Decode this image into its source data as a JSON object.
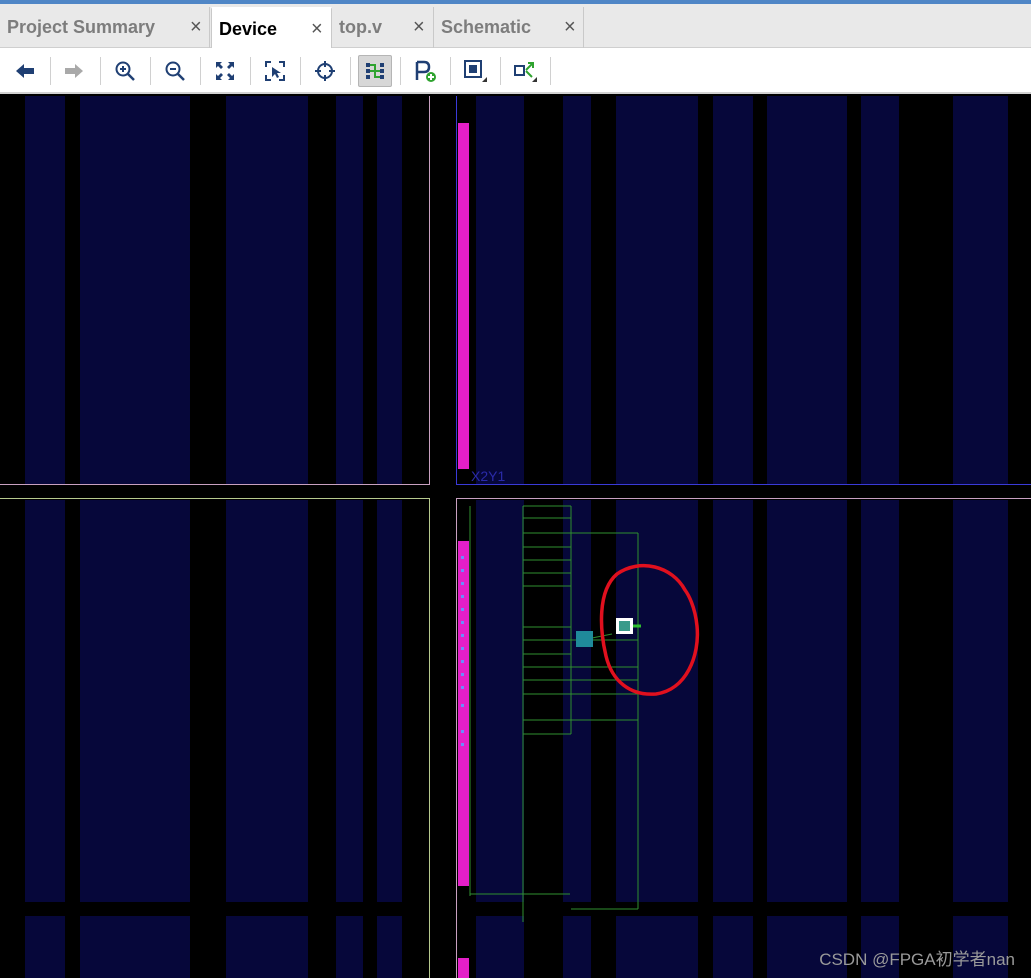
{
  "tabs": [
    {
      "label": "Project Summary",
      "active": false
    },
    {
      "label": "Device",
      "active": true
    },
    {
      "label": "top.v",
      "active": false
    },
    {
      "label": "Schematic",
      "active": false
    }
  ],
  "close_glyph": "×",
  "toolbar": {
    "buttons": [
      {
        "icon": "back-arrow-icon"
      },
      {
        "icon": "forward-arrow-icon"
      },
      {
        "icon": "zoom-in-icon"
      },
      {
        "icon": "zoom-out-icon"
      },
      {
        "icon": "zoom-fit-icon"
      },
      {
        "icon": "zoom-selection-icon"
      },
      {
        "icon": "crosshair-icon"
      },
      {
        "icon": "routing-resources-icon",
        "pressed": true
      },
      {
        "icon": "add-pblock-icon"
      },
      {
        "icon": "fixed-cells-icon"
      },
      {
        "icon": "autofit-selection-icon"
      }
    ]
  },
  "device_view": {
    "clock_region_label": "X2Y1",
    "colors": {
      "background": "#000000",
      "tile_column": "#06073a",
      "io_bank": "#e41fc8",
      "route": "#2fa32f",
      "annotation_circle": "#e0101e",
      "region_top": "#c8a0c0",
      "region_left_bottom": "#b6c98e",
      "region_selected": "#3a3ad8"
    }
  },
  "watermark": "CSDN @FPGA初学者nan"
}
